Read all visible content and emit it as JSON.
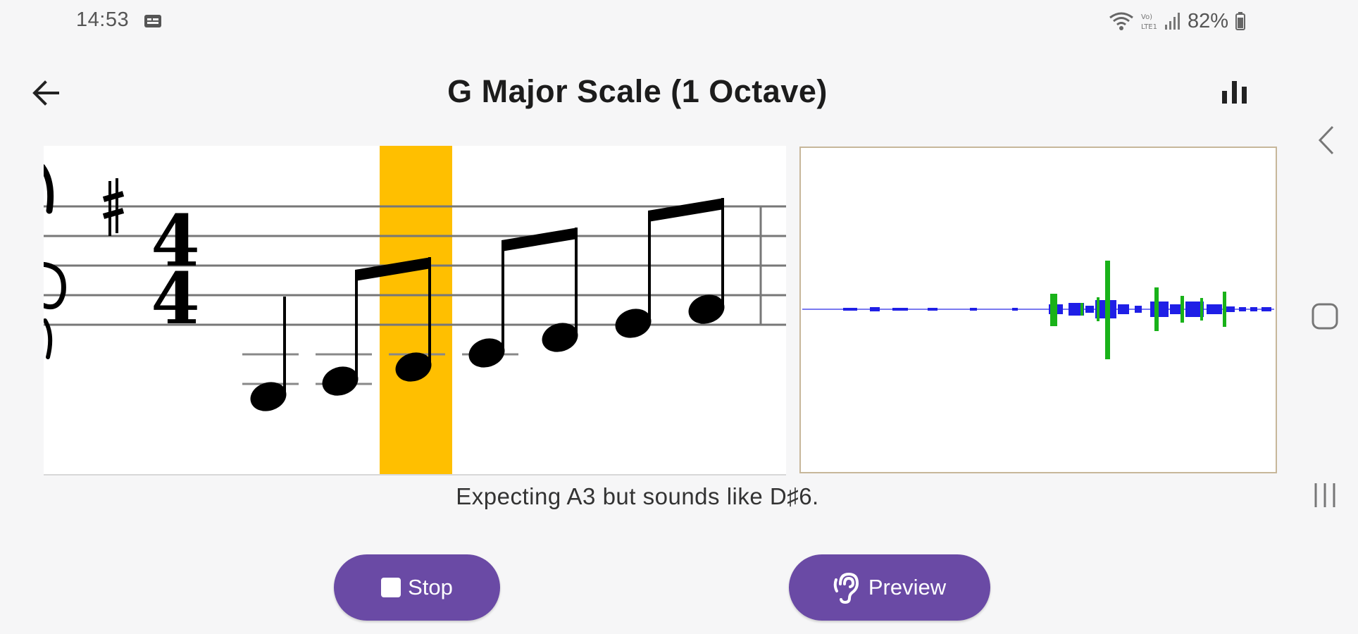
{
  "status_bar": {
    "time": "14:53",
    "battery_percent": "82%",
    "icons": [
      "notification-icon",
      "wifi-icon",
      "signal-icon",
      "battery-icon"
    ]
  },
  "app_bar": {
    "title": "G Major Scale (1 Octave)",
    "icons": [
      "back-arrow-icon",
      "bar-chart-icon"
    ]
  },
  "score": {
    "clef": "treble",
    "key_signature": "G major (1 sharp)",
    "time_signature": {
      "top": "4",
      "bottom": "4"
    },
    "highlight_color": "#ffbf00",
    "highlighted_note_index": 2
  },
  "waveform": {
    "colors": {
      "signal": "#1f1fe6",
      "peaks": "#19b219",
      "border": "#c7b79a"
    }
  },
  "feedback_text": "Expecting A3 but sounds like D♯6.",
  "buttons": {
    "stop_label": "Stop",
    "preview_label": "Preview"
  },
  "colors": {
    "accent": "#6a4aa5",
    "background": "#f6f6f7"
  }
}
